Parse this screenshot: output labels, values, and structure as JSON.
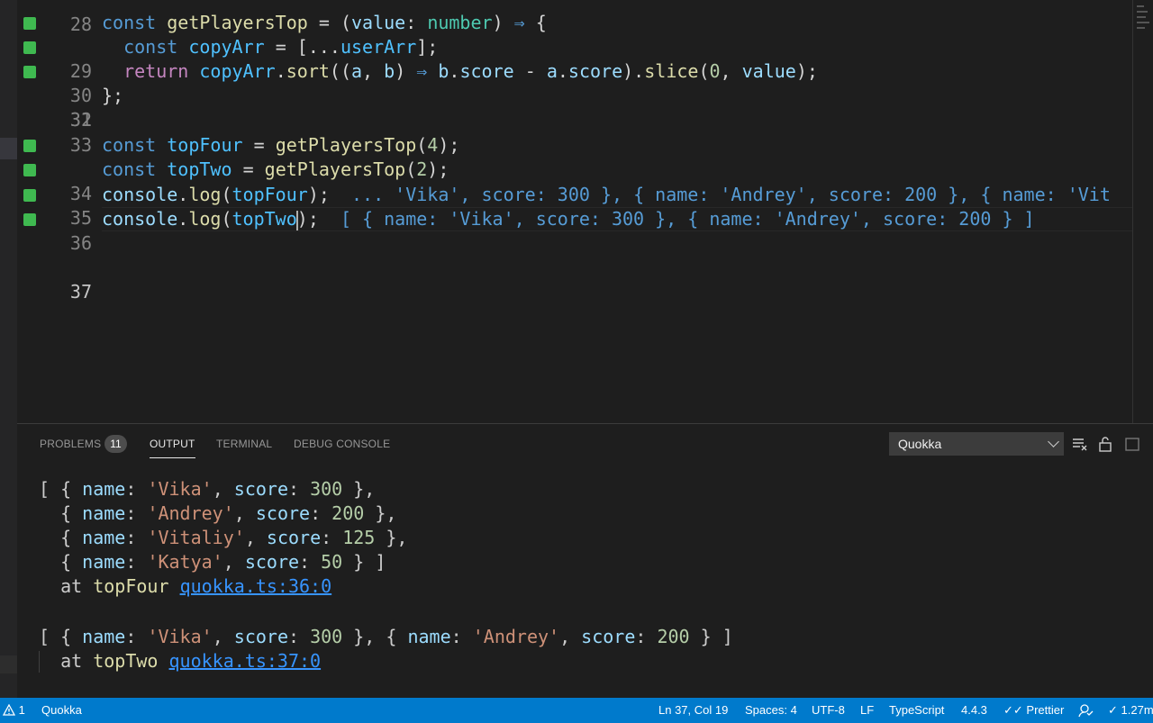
{
  "editor": {
    "lines": [
      {
        "num": "28",
        "partial": true
      },
      {
        "num": "29"
      },
      {
        "num": "30"
      },
      {
        "num": "31"
      },
      {
        "num": "32"
      },
      {
        "num": "33"
      },
      {
        "num": "34"
      },
      {
        "num": "35"
      },
      {
        "num": "36"
      },
      {
        "num": "37"
      }
    ],
    "inline_results": {
      "line36": "... 'Vika', score: 300 }, { name: 'Andrey', score: 200 }, { name: 'Vit",
      "line37": "[ { name: 'Vika', score: 300 }, { name: 'Andrey', score: 200 } ]"
    }
  },
  "panel": {
    "tabs": {
      "problems": "PROBLEMS",
      "problems_count": "11",
      "output": "OUTPUT",
      "terminal": "TERMINAL",
      "debug_console": "DEBUG CONSOLE"
    },
    "channel_select": "Quokka",
    "output": {
      "block1_locations": {
        "label": "topFour",
        "link": "quokka.ts:36:0"
      },
      "block2_locations": {
        "label": "topTwo",
        "link": "quokka.ts:37:0"
      }
    }
  },
  "statusbar": {
    "warnings": "1",
    "quokka": "Quokka",
    "position": "Ln 37, Col 19",
    "spaces": "Spaces: 4",
    "encoding": "UTF-8",
    "eol": "LF",
    "language": "TypeScript",
    "ts_version": "4.4.3",
    "prettier": "Prettier",
    "quokka_time": "1.27m"
  },
  "colors": {
    "statusbar": "#007acc",
    "editor_bg": "#1e1e1e",
    "gutter_mark": "#3fb950",
    "link": "#3794ff"
  },
  "icons": [
    "warning-icon",
    "check-double-icon",
    "feedback-icon",
    "check-icon",
    "chevron-down-icon",
    "clear-output-icon",
    "lock-icon",
    "maximize-icon"
  ]
}
